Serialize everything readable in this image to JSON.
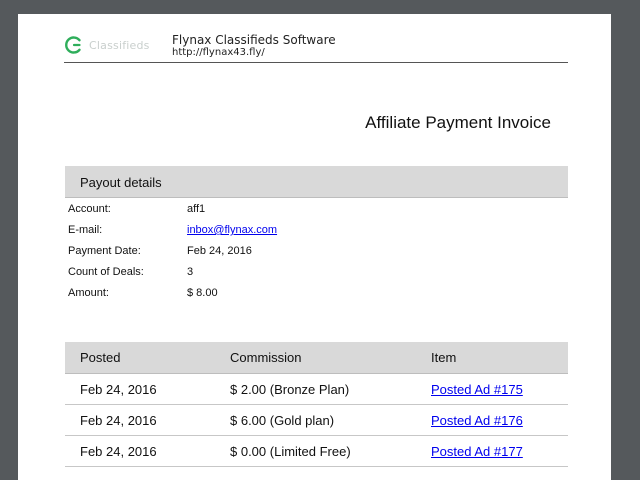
{
  "header": {
    "logo_text": "Classifieds",
    "company_name": "Flynax Classifieds Software",
    "company_url": "http://flynax43.fly/"
  },
  "invoice": {
    "title": "Affiliate Payment Invoice"
  },
  "payout": {
    "section_title": "Payout details",
    "rows": [
      {
        "label": "Account:",
        "value": "aff1"
      },
      {
        "label": "E-mail:",
        "value": "inbox@flynax.com"
      },
      {
        "label": "Payment Date:",
        "value": "Feb 24, 2016"
      },
      {
        "label": "Count of Deals:",
        "value": "3"
      },
      {
        "label": "Amount:",
        "value": "$ 8.00"
      }
    ]
  },
  "deals": {
    "columns": [
      "Posted",
      "Commission",
      "Item"
    ],
    "rows": [
      {
        "posted": "Feb 24, 2016",
        "commission": "$ 2.00 (Bronze Plan)",
        "item": "Posted Ad #175"
      },
      {
        "posted": "Feb 24, 2016",
        "commission": "$ 6.00 (Gold plan)",
        "item": "Posted Ad #176"
      },
      {
        "posted": "Feb 24, 2016",
        "commission": "$ 0.00 (Limited Free)",
        "item": "Posted Ad #177"
      }
    ]
  },
  "colors": {
    "link": "#0000ee",
    "section_bg": "#d9d9d9",
    "logo_green": "#2fae5b"
  }
}
